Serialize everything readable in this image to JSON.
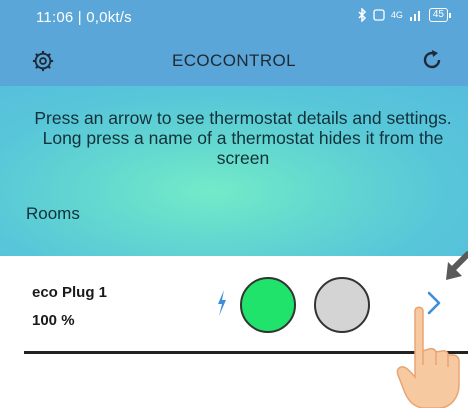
{
  "status_bar": {
    "time_speed": "11:06 | 0,0kt/s",
    "network": "4G",
    "battery": "45",
    "icons": [
      "nfc-icon",
      "media-icon",
      "chrome-icon",
      "lock-icon",
      "bluetooth-icon",
      "nfc-badge-icon",
      "signal-icon",
      "battery-icon"
    ]
  },
  "app_bar": {
    "title": "ECOCONTROL",
    "left_icon": "gear-icon",
    "right_icon": "refresh-icon"
  },
  "info": {
    "line1": "Press an arrow to see thermostat details and settings.",
    "line2": "Long press a name of a thermostat hides it from the",
    "line3": "screen",
    "rooms_label": "Rooms"
  },
  "device": {
    "name": "eco Plug 1",
    "percent": "100 %",
    "power_icon": "bolt-icon",
    "on_color": "#1fe36a",
    "off_color": "#d4d4d4",
    "open_icon": "chevron-right-icon"
  },
  "colors": {
    "app_bar": "#5aa6d8",
    "accent_blue": "#3d8fd9",
    "panel_center": "#73ebc8",
    "panel_edge": "#56bddd"
  }
}
